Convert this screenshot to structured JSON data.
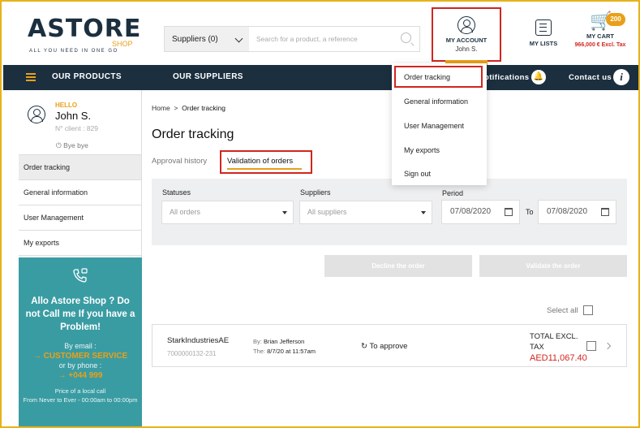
{
  "brand": {
    "logo_text": "ASTORE",
    "logo_sub": "SHOP",
    "tagline": "ALL YOU NEED IN ONE GO"
  },
  "search": {
    "category_label": "Suppliers (0)",
    "placeholder": "Search for a product, a reference"
  },
  "account": {
    "label": "MY ACCOUNT",
    "user": "John S."
  },
  "lists": {
    "label": "MY LISTS"
  },
  "cart": {
    "badge": "200",
    "label": "MY CART",
    "amount": "966,000 € Excl. Tax"
  },
  "nav": {
    "products": "OUR PRODUCTS",
    "suppliers": "OUR SUPPLIERS",
    "notifications": "otifications",
    "contact": "Contact us"
  },
  "dropdown": {
    "items": [
      "Order tracking",
      "General information",
      "User Management",
      "My exports",
      "Sign out"
    ]
  },
  "sidebar": {
    "hello": "HELLO",
    "name": "John S.",
    "client": "N° client : 829",
    "bye": "Bye bye",
    "items": [
      "Order tracking",
      "General information",
      "User Management",
      "My exports"
    ],
    "promo": {
      "title": "Allo Astore Shop ? Do not Call me If you have a Problem!",
      "by_email": "By email :",
      "service": "CUSTOMER SERVICE",
      "by_phone": "or by phone :",
      "phone": "+044 999",
      "price": "Price of a local call",
      "hours": "From Never to Ever - 00:00am to 00:00pm"
    }
  },
  "main": {
    "breadcrumb_home": "Home",
    "breadcrumb_sep": ">",
    "breadcrumb_current": "Order tracking",
    "title": "Order tracking",
    "tab_history": "Approval history",
    "tab_validation": "Validation of orders",
    "filters": {
      "statuses_label": "Statuses",
      "statuses_value": "All orders",
      "suppliers_label": "Suppliers",
      "suppliers_value": "All suppliers",
      "period_label": "Period",
      "date_from": "07/08/2020",
      "to_label": "To",
      "date_to": "07/08/2020"
    },
    "decline_btn": "Decline the order",
    "validate_btn": "Validate the order",
    "select_all": "Select all",
    "order": {
      "company": "StarkIndustriesAE",
      "id": "7000000132-231",
      "by_label": "By:",
      "by_value": "Brian Jefferson",
      "the_label": "The:",
      "the_value": "8/7/20 at 11:57am",
      "status": "To approve",
      "total_label": "TOTAL EXCL. TAX",
      "amount": "AED11,067.40"
    }
  },
  "colors": {
    "navy": "#1b2f3f",
    "accent": "#e8a01a",
    "highlight": "#d0261f",
    "teal": "#3a9ca3"
  }
}
